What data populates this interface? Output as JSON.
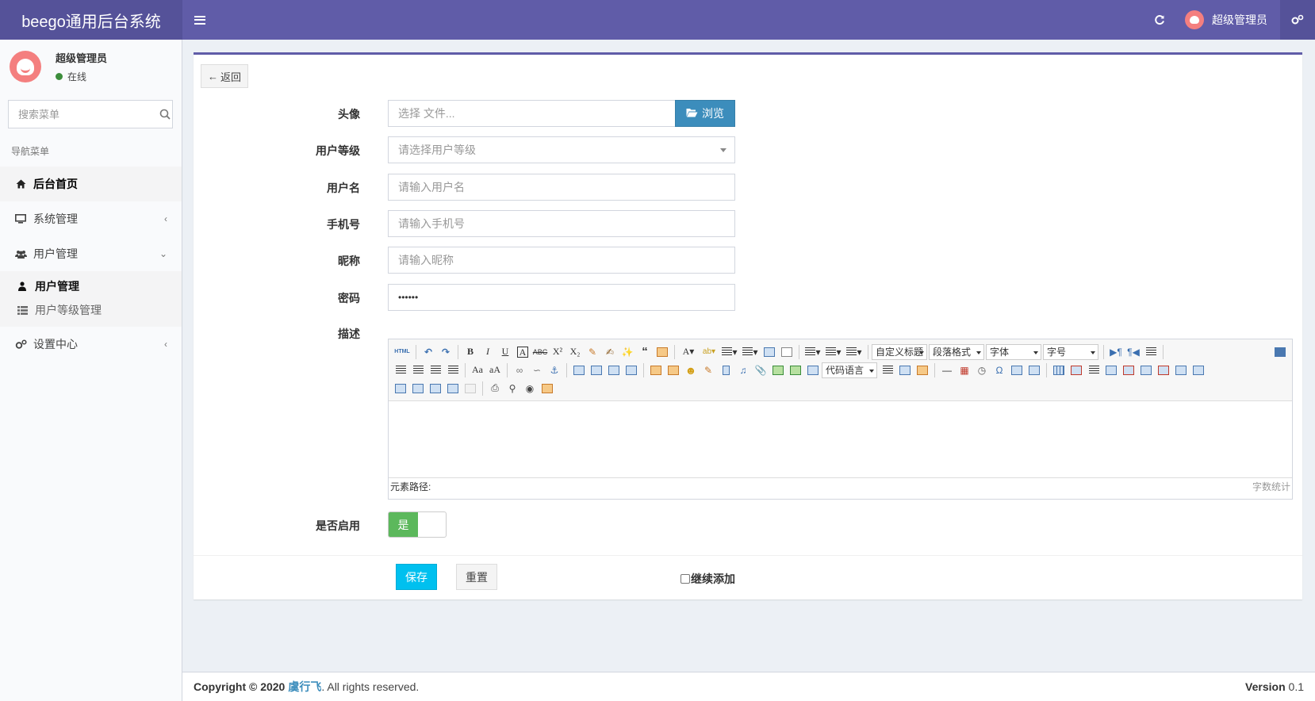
{
  "header": {
    "brand": "beego通用后台系统",
    "user_name": "超级管理员"
  },
  "sidebar": {
    "user_name": "超级管理员",
    "status": "在线",
    "search_placeholder": "搜索菜单",
    "nav_header": "导航菜单",
    "items": [
      {
        "label": "后台首页"
      },
      {
        "label": "系统管理"
      },
      {
        "label": "用户管理"
      },
      {
        "label": "设置中心"
      }
    ],
    "sub_items": [
      {
        "label": "用户管理"
      },
      {
        "label": "用户等级管理"
      }
    ]
  },
  "form": {
    "back_label": "返回",
    "avatar_label": "头像",
    "avatar_placeholder": "选择 文件...",
    "browse_label": "浏览",
    "level_label": "用户等级",
    "level_placeholder": "请选择用户等级",
    "username_label": "用户名",
    "username_placeholder": "请输入用户名",
    "phone_label": "手机号",
    "phone_placeholder": "请输入手机号",
    "nickname_label": "昵称",
    "nickname_placeholder": "请输入昵称",
    "password_label": "密码",
    "password_value": "••••••",
    "desc_label": "描述",
    "enable_label": "是否启用",
    "enable_on": "是",
    "save_label": "保存",
    "reset_label": "重置",
    "continue_label": "继续添加"
  },
  "editor": {
    "html_label": "HTML",
    "select_heading": "自定义标题",
    "select_paragraph": "段落格式",
    "select_font": "字体",
    "select_size": "字号",
    "select_code": "代码语言",
    "path_label": "元素路径:",
    "count_label": "字数统计"
  },
  "footer": {
    "copyright": "Copyright © 2020",
    "author": "虞行飞",
    "rights": ". All rights reserved.",
    "version_label": "Version",
    "version": "0.1"
  },
  "colors": {
    "header": "#605ca8",
    "header_dark": "#555299",
    "primary": "#3c8dbc",
    "info": "#00c0ef",
    "success": "#5cb85c"
  }
}
